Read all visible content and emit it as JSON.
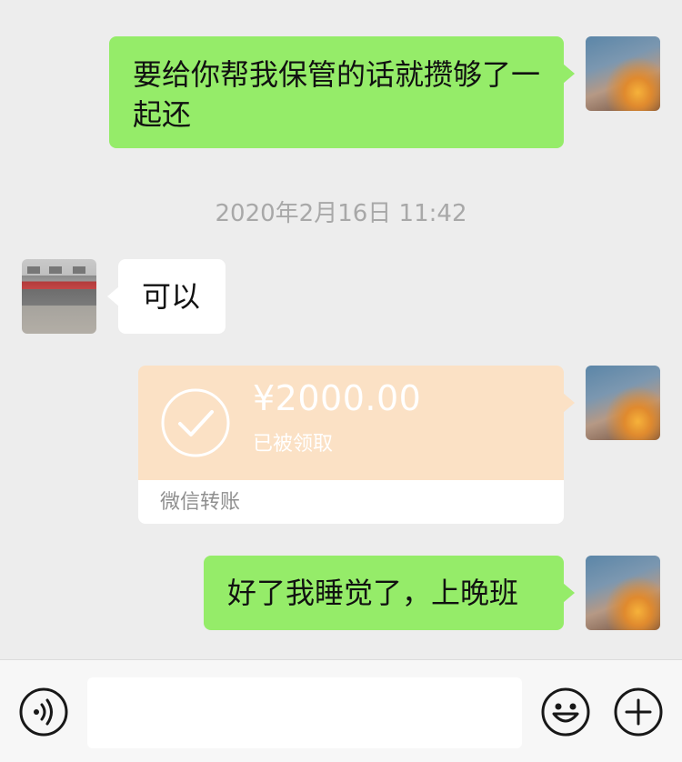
{
  "messages": {
    "m1": {
      "sender": "me",
      "text": "要给你帮我保管的话就攒够了一起还"
    },
    "timestamp": "2020年2月16日 11:42",
    "m2": {
      "sender": "other",
      "text": "可以"
    },
    "transfer": {
      "amount": "¥2000.00",
      "status": "已被领取",
      "label": "微信转账"
    },
    "m3": {
      "sender": "me",
      "text": "好了我睡觉了，上晚班"
    }
  },
  "input_bar": {
    "voice_icon": "voice-icon",
    "text_value": "",
    "emoji_icon": "emoji-icon",
    "plus_icon": "plus-icon"
  },
  "colors": {
    "sent_bubble": "#95ec69",
    "received_bubble": "#ffffff",
    "transfer_card": "#fbe1c5",
    "background": "#ededed"
  }
}
